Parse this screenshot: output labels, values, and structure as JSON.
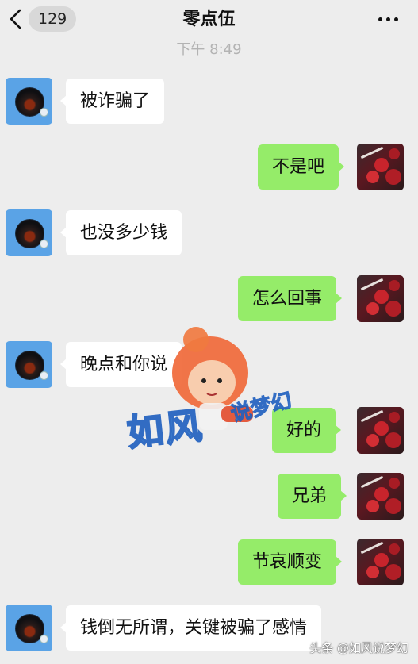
{
  "header": {
    "unread_count": "129",
    "title": "零点伍"
  },
  "timestamp": "下午 8:49",
  "messages": [
    {
      "side": "left",
      "text": "被诈骗了"
    },
    {
      "side": "right",
      "text": "不是吧"
    },
    {
      "side": "left",
      "text": "也没多少钱"
    },
    {
      "side": "right",
      "text": "怎么回事"
    },
    {
      "side": "left",
      "text": "晚点和你说"
    },
    {
      "side": "right",
      "text": "好的"
    },
    {
      "side": "right",
      "text": "兄弟"
    },
    {
      "side": "right",
      "text": "节哀顺变"
    },
    {
      "side": "left",
      "text": "钱倒无所谓，关键被骗了感情"
    }
  ],
  "watermark": {
    "main": "如风",
    "sub": "说梦幻"
  },
  "source_credit": "头条 @如风说梦幻",
  "colors": {
    "background": "#ededed",
    "own_bubble": "#95ec69",
    "other_bubble": "#ffffff"
  },
  "icons": {
    "back": "chevron-left-icon",
    "more": "more-dots-icon"
  }
}
